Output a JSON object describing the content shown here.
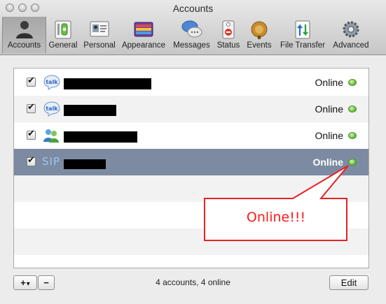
{
  "window": {
    "title": "Accounts"
  },
  "toolbar": {
    "items": [
      {
        "label": "Accounts",
        "icon": "accounts-icon",
        "selected": true
      },
      {
        "label": "General",
        "icon": "general-icon"
      },
      {
        "label": "Personal",
        "icon": "personal-icon"
      },
      {
        "label": "Appearance",
        "icon": "appearance-icon"
      },
      {
        "label": "Messages",
        "icon": "messages-icon"
      },
      {
        "label": "Status",
        "icon": "status-icon"
      },
      {
        "label": "Events",
        "icon": "events-icon"
      },
      {
        "label": "File Transfer",
        "icon": "file-transfer-icon"
      },
      {
        "label": "Advanced",
        "icon": "advanced-icon"
      }
    ]
  },
  "accounts": [
    {
      "service": "talk",
      "enabled": true,
      "status": "Online"
    },
    {
      "service": "talk",
      "enabled": true,
      "status": "Online"
    },
    {
      "service": "msn",
      "enabled": true,
      "status": "Online"
    },
    {
      "service": "SIP",
      "enabled": true,
      "status": "Online",
      "selected": true
    }
  ],
  "footer": {
    "add_label": "+",
    "add_menu_glyph": "▾",
    "remove_label": "−",
    "summary": "4 accounts, 4 online",
    "edit_label": "Edit"
  },
  "annotation": {
    "text": "Online!!!",
    "color": "#ff1a1a"
  },
  "colors": {
    "selection": "#7c8ba1",
    "online_dot": "#58b53a"
  }
}
